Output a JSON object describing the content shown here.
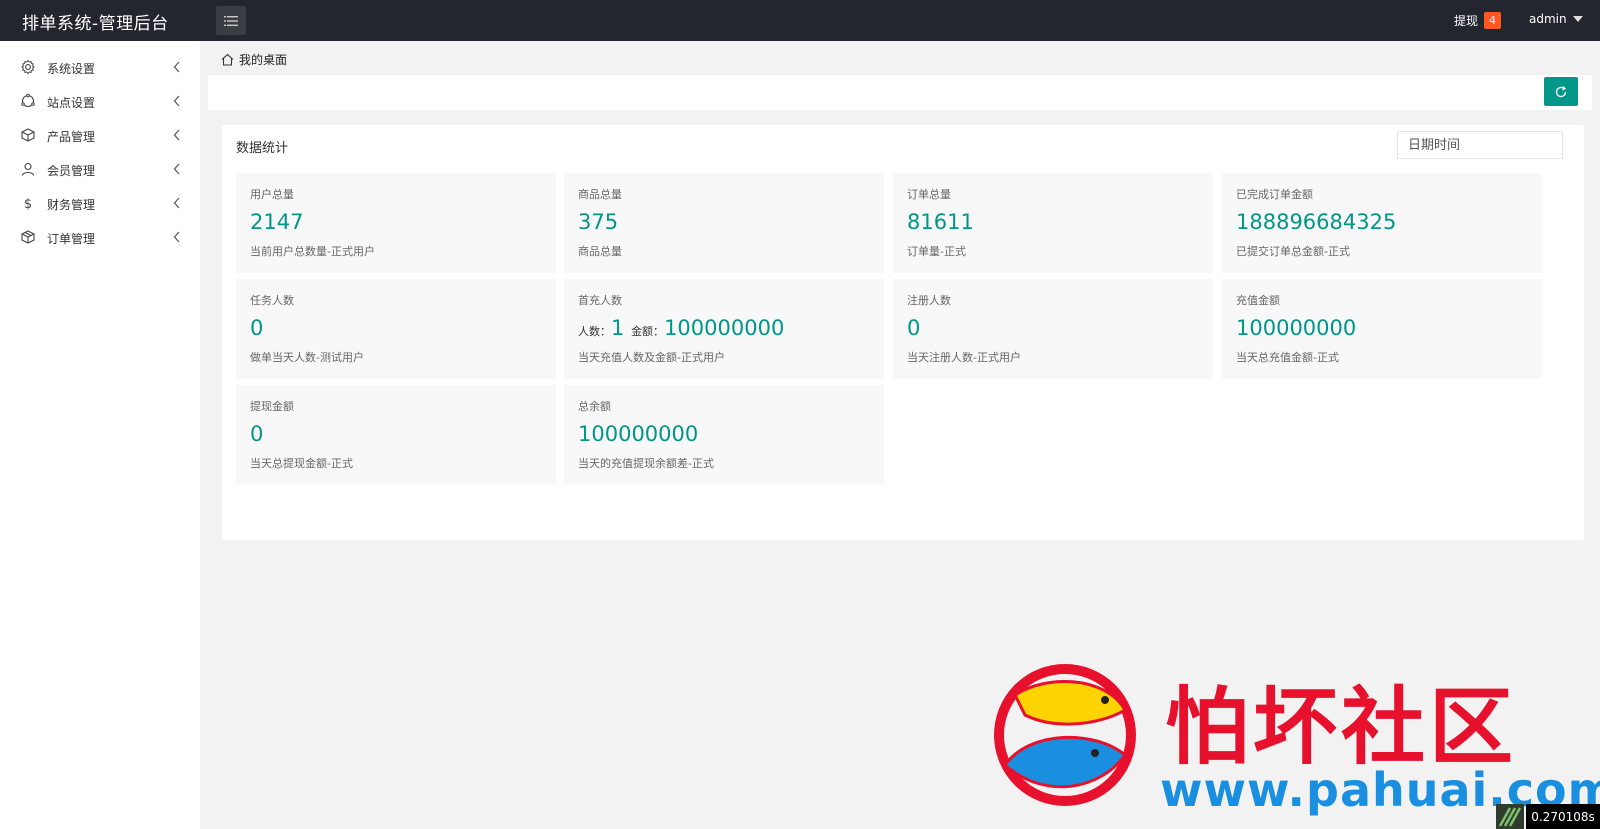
{
  "header": {
    "app_title": "排单系统-管理后台",
    "withdraw_label": "提现",
    "withdraw_count": "4",
    "user_name": "admin"
  },
  "sidebar": {
    "items": [
      {
        "label": "系统设置",
        "icon": "gear-icon"
      },
      {
        "label": "站点设置",
        "icon": "globe-icon"
      },
      {
        "label": "产品管理",
        "icon": "box-icon"
      },
      {
        "label": "会员管理",
        "icon": "user-icon"
      },
      {
        "label": "财务管理",
        "icon": "dollar-icon"
      },
      {
        "label": "订单管理",
        "icon": "package-icon"
      }
    ]
  },
  "breadcrumb": {
    "label": "我的桌面"
  },
  "panel": {
    "title": "数据统计",
    "date_placeholder": "日期时间",
    "cards": [
      {
        "label": "用户总量",
        "value": "2147",
        "desc": "当前用户总数量-正式用户"
      },
      {
        "label": "商品总量",
        "value": "375",
        "desc": "商品总量"
      },
      {
        "label": "订单总量",
        "value": "81611",
        "desc": "订单量-正式"
      },
      {
        "label": "已完成订单金额",
        "value": "188896684325",
        "desc": "已提交订单总金额-正式"
      },
      {
        "label": "任务人数",
        "value": "0",
        "desc": "做单当天人数-测试用户"
      },
      {
        "label": "首充人数",
        "people_label": "人数：",
        "people_value": "1",
        "amount_label": "金额：",
        "amount_value": "100000000",
        "desc": "当天充值人数及金额-正式用户"
      },
      {
        "label": "注册人数",
        "value": "0",
        "desc": "当天注册人数-正式用户"
      },
      {
        "label": "充值金额",
        "value": "100000000",
        "desc": "当天总充值金额-正式"
      },
      {
        "label": "提现金额",
        "value": "0",
        "desc": "当天总提现金额-正式"
      },
      {
        "label": "总余额",
        "value": "100000000",
        "desc": "当天的充值提现余额差-正式"
      }
    ]
  },
  "timer": "0.270108s",
  "watermark": {
    "text": "怕坏社区",
    "url": "www.pahuai.com"
  },
  "colors": {
    "accent": "#009688",
    "header_bg": "#23262e",
    "badge": "#ff5722"
  }
}
